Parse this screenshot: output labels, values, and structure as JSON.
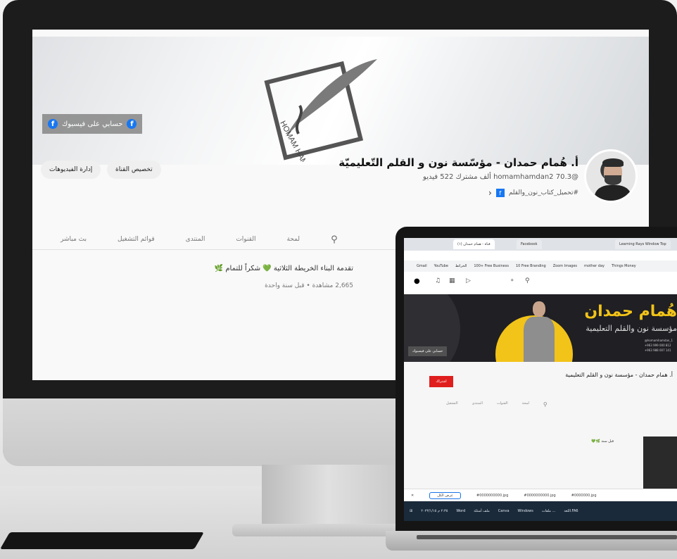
{
  "desktop": {
    "banner_link": "حسابي على فيسبوك",
    "channel": {
      "name": "أ. هُمام حمدان - مؤسّسة نون و القلم التّعليميّة",
      "handle": "@homamhamdan2",
      "subscribers": "70.3 ألف مشترك",
      "videos": "522 فيديو",
      "tagline": "#تحميل_كتاب_نون_والقلم",
      "logo_text": "HOMAM HAMADAN"
    },
    "buttons": {
      "customize": "تخصيص القناة",
      "manage_videos": "إدارة الفيديوهات"
    },
    "tabs": [
      "بث مباشر",
      "قوائم التشغيل",
      "المنتدى",
      "القنوات",
      "لمحة"
    ],
    "post": {
      "text": "تقدمة البناء الخريطة الثلاثية 💚 شكراً للتمام 🌿",
      "meta": "2,665 مشاهدة • قبل سنة واحدة"
    }
  },
  "laptop": {
    "browser_tabs": [
      "(١) قناة - همام حمدان",
      "Facebook",
      "Learning Rays Window Top"
    ],
    "bookmarks": [
      "Gmail",
      "YouTube",
      "الخرائط",
      "100+ Free Business",
      "10 Free Branding",
      "Zoom Images",
      "mother day",
      "Things Money"
    ],
    "banner": {
      "title": "هُمام حمدان",
      "subtitle": "مؤسسة نون والقلم التعليمية",
      "contact": [
        "@homamhamdan_1",
        "+963 999 000 812",
        "+963 988 007 141"
      ],
      "fb_link": "حسابي على فيسبوك"
    },
    "channel_name": "أ. همام حمدان - مؤسسة نون و القلم التعليمية",
    "subscribe": "اشتراك",
    "tabs": [
      "التشغيل",
      "المنتدى",
      "القنوات",
      "لمحة"
    ],
    "post": "قبل سنة 🌿💚",
    "findbar": {
      "query": "عرض الكل",
      "files": [
        "#0000000000.jpg",
        "#0000000000.jpg",
        "#0000000.jpg"
      ]
    },
    "taskbar": {
      "time": "٢:٣٥ م",
      "date": "٢٠٢٣/١/١٥",
      "apps": [
        "Word",
        "ملف أسئلة",
        "Canva",
        "Windows",
        "ملفات ...",
        "اللغة.FA6"
      ]
    }
  }
}
